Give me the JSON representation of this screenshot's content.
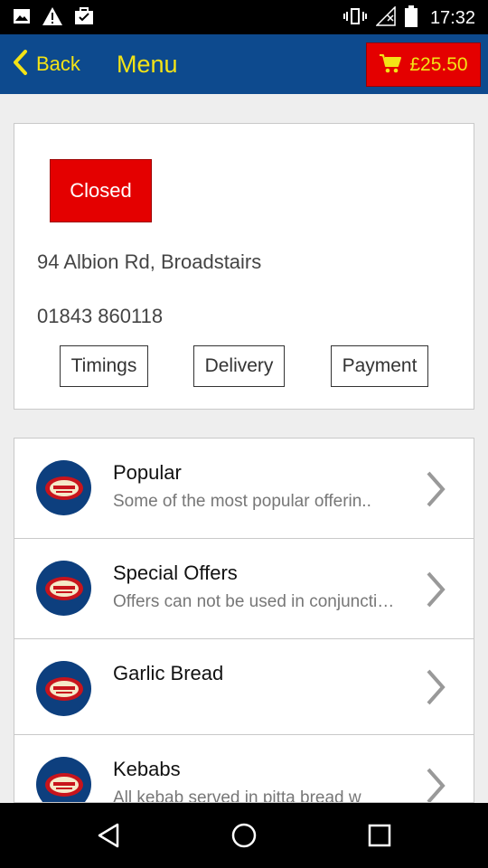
{
  "status_bar": {
    "time": "17:32",
    "left_icons": [
      "image-icon",
      "warning-icon",
      "briefcase-check-icon"
    ],
    "right_icons": [
      "vibrate-icon",
      "no-signal-icon",
      "battery-icon"
    ]
  },
  "app_bar": {
    "back_label": "Back",
    "title": "Menu",
    "cart_total": "£25.50",
    "accent_color": "#f3e316",
    "bar_color": "#0d4a8e",
    "cart_color": "#e40000"
  },
  "restaurant": {
    "status": "Closed",
    "address": "94 Albion Rd, Broadstairs",
    "phone": "01843 860118",
    "buttons": [
      "Timings",
      "Delivery",
      "Payment"
    ]
  },
  "categories": [
    {
      "title": "Popular",
      "description": "Some of the most popular offerin.."
    },
    {
      "title": "Special Offers",
      "description": "Offers can not be used in conjunction with any other offer"
    },
    {
      "title": "Garlic Bread",
      "description": ""
    },
    {
      "title": "Kebabs",
      "description": "All kebab served in pitta bread w"
    }
  ]
}
